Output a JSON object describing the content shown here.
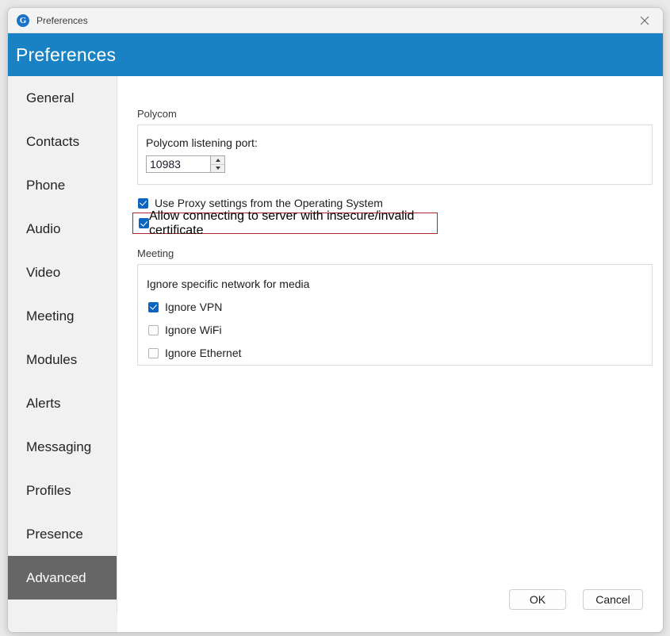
{
  "window": {
    "app_icon": "g-logo-icon",
    "titlebar_title": "Preferences",
    "close_icon": "close-icon",
    "header_title": "Preferences",
    "header_color": "#1982c4"
  },
  "sidebar": {
    "selected": "Advanced",
    "selected_bg": "#666666",
    "items": [
      {
        "label": "General"
      },
      {
        "label": "Contacts"
      },
      {
        "label": "Phone"
      },
      {
        "label": "Audio"
      },
      {
        "label": "Video"
      },
      {
        "label": "Meeting"
      },
      {
        "label": "Modules"
      },
      {
        "label": "Alerts"
      },
      {
        "label": "Messaging"
      },
      {
        "label": "Profiles"
      },
      {
        "label": "Presence"
      },
      {
        "label": "Advanced"
      }
    ]
  },
  "content": {
    "polycom": {
      "group_label": "Polycom",
      "port_label": "Polycom listening port:",
      "port_value": "10983",
      "port_placeholder": "",
      "stepper_up_icon": "chevron-up-icon",
      "stepper_down_icon": "chevron-down-icon"
    },
    "checkboxes": {
      "proxy": {
        "label": "Use Proxy settings from the Operating System",
        "checked": true
      },
      "insecure": {
        "label": "Allow connecting to server with insecure/invalid certificate",
        "checked": true,
        "highlighted": true,
        "highlight_color": "#b0252b"
      }
    },
    "meeting": {
      "group_label": "Meeting",
      "section_label": "Ignore specific network for media",
      "options": [
        {
          "label": "Ignore VPN",
          "checked": true
        },
        {
          "label": "Ignore WiFi",
          "checked": false
        },
        {
          "label": "Ignore Ethernet",
          "checked": false
        }
      ]
    }
  },
  "footer": {
    "ok_label": "OK",
    "cancel_label": "Cancel"
  }
}
